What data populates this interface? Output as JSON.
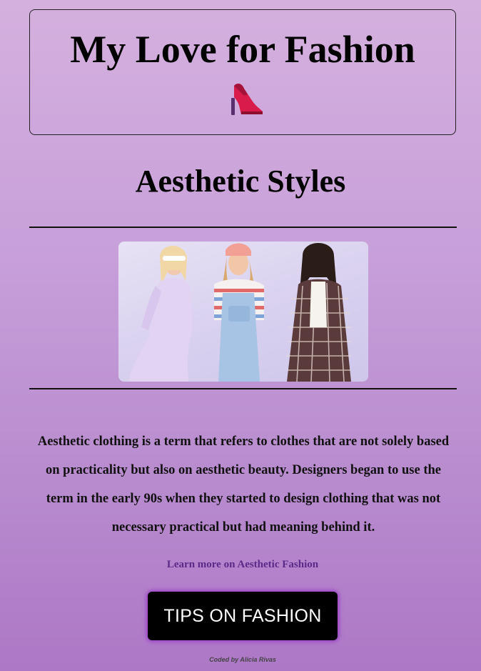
{
  "header": {
    "title": "My Love for Fashion",
    "icon": "high-heel-shoe-icon"
  },
  "section": {
    "heading": "Aesthetic Styles"
  },
  "photo": {
    "subject": "three women modeling aesthetic outfits"
  },
  "content": {
    "paragraph": "Aesthetic clothing is a term that refers to clothes that are not solely based on practicality but also on aesthetic beauty. Designers began to use the term in the early 90s when they started to design clothing that was not necessary practical but had meaning behind it."
  },
  "links": {
    "learn_more": "Learn more on Aesthetic Fashion"
  },
  "buttons": {
    "tips": "TIPS ON FASHION"
  },
  "footer": {
    "credit": "Coded by Alicia Rivas"
  },
  "colors": {
    "background_top": "#d4b0de",
    "background_bottom": "#ad78c6",
    "link": "#5b2a88",
    "button_bg": "#000000",
    "button_glow": "#9b3fc8",
    "heel": "#d81b4a"
  }
}
